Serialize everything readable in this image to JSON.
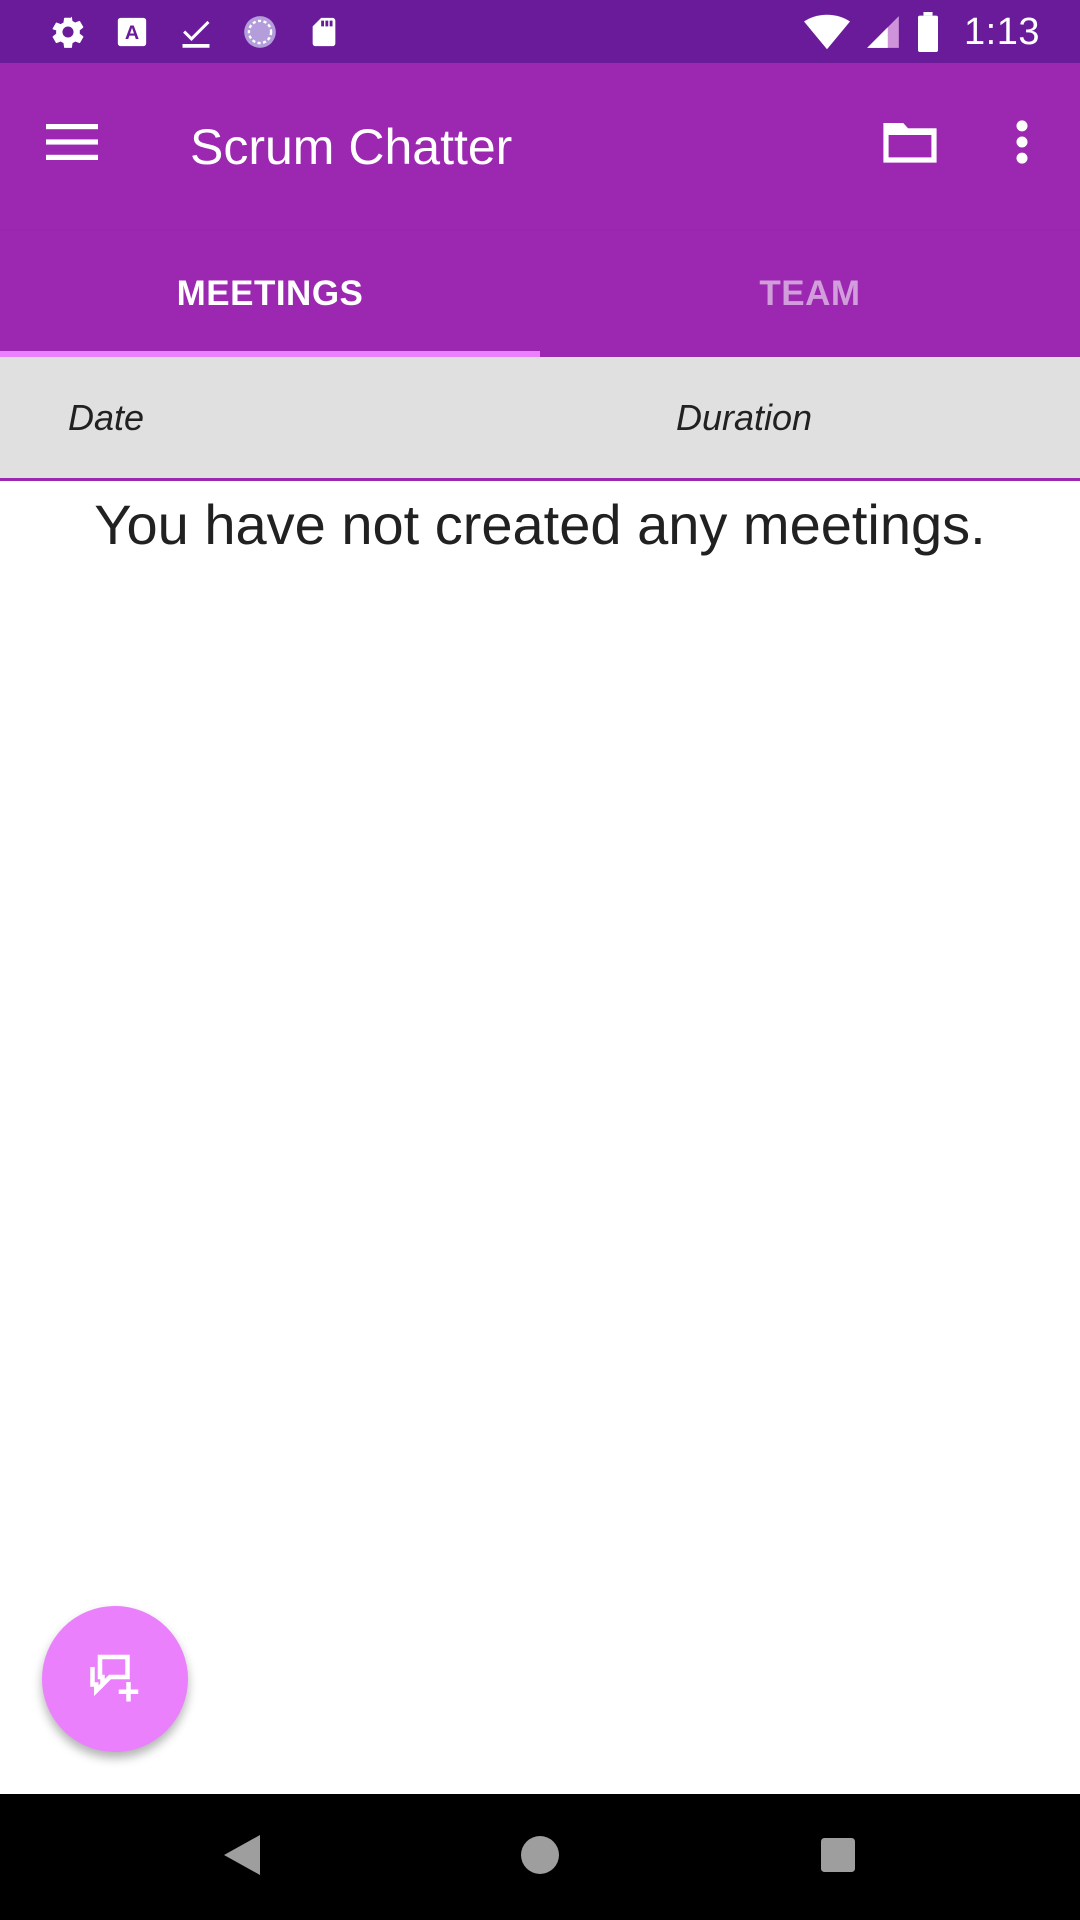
{
  "status_bar": {
    "time": "1:13",
    "left_icons": [
      "settings-icon",
      "font-a-icon",
      "download-done-icon",
      "sync-circle-icon",
      "sd-card-icon"
    ],
    "right_icons": [
      "wifi-icon",
      "signal-icon",
      "battery-icon"
    ],
    "background": "#6a1b9a"
  },
  "app_bar": {
    "title": "Scrum Chatter",
    "background": "#9c27b0",
    "actions": [
      "menu-icon",
      "folder-icon",
      "more-vert-icon"
    ]
  },
  "tabs": [
    {
      "label": "MEETINGS",
      "active": true
    },
    {
      "label": "TEAM",
      "active": false
    }
  ],
  "tab_indicator_color": "#ea80fc",
  "table_header": {
    "date_label": "Date",
    "duration_label": "Duration"
  },
  "empty_state": {
    "message": "You have not created any meetings."
  },
  "fab": {
    "icon": "add-chat-icon",
    "color": "#ea80fc"
  },
  "nav_bar": {
    "buttons": [
      "back-icon",
      "home-icon",
      "recents-icon"
    ]
  }
}
